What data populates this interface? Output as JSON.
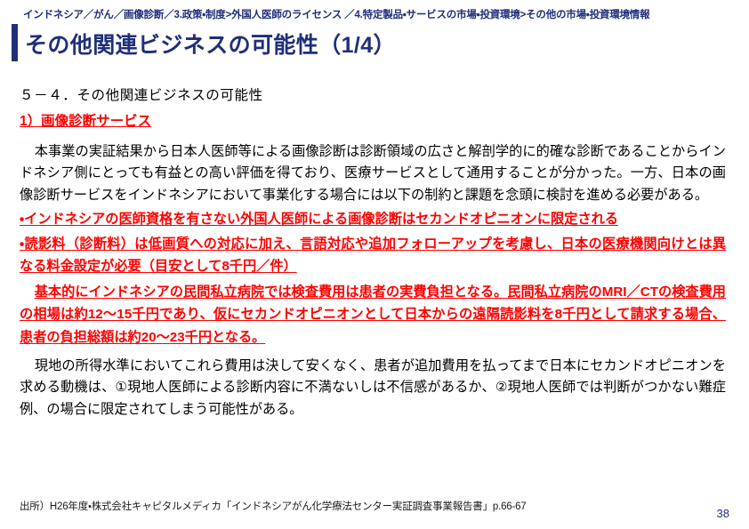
{
  "header": {
    "breadcrumb": "インドネシア／がん／画像診断／3.政策・制度>外国人医師のライセンス ／4.特定製品・サービスの市場・投資環境>その他の市場・投資環境情報",
    "title": "その他関連ビジネスの可能性（1/4）",
    "accent_color": "#1f2f7a"
  },
  "content": {
    "section_heading": "５－４．その他関連ビジネスの可能性",
    "sub_heading": "1）画像診断サービス",
    "paragraph_1": "本事業の実証結果から日本人医師等による画像診断は診断領域の広さと解剖学的に的確な診断であることからインドネシア側にとっても有益との高い評価を得ており、医療サービスとして通用することが分かった。一方、日本の画像診断サービスをインドネシアにおいて事業化する場合には以下の制約と課題を念頭に検討を進める必要がある。",
    "bullet_1": "・インドネシアの医師資格を有さない外国人医師による画像診断はセカンドオピニオンに限定される",
    "bullet_2": "・読影料（診断料）は低画質への対応に加え、言語対応や追加フォローアップを考慮し、日本の医療機関向けとは異なる料金設定が必要（目安として8千円／件）",
    "emphasis_block": "基本的にインドネシアの民間私立病院では検査費用は患者の実費負担となる。民間私立病院のMRI／CTの検査費用の相場は約12〜15千円であり、仮にセカンドオピニオンとして日本からの遠隔読影料を8千円として請求する場合、患者の負担総額は約20〜23千円となる。",
    "paragraph_2": "現地の所得水準においてこれら費用は決して安くなく、患者が追加費用を払ってまで日本にセカンドオピニオンを求める動機は、①現地人医師による診断内容に不満ないしは不信感があるか、②現地人医師では判断がつかない難症例、の場合に限定されてしまう可能性がある。",
    "emphasis_color": "#ff0000",
    "body_color": "#000000"
  },
  "footer": {
    "source": "出所）H26年度・株式会社キャピタルメディカ「インドネシアがん化学療法センター実証調査事業報告書」p.66-67",
    "page_number": "38"
  }
}
